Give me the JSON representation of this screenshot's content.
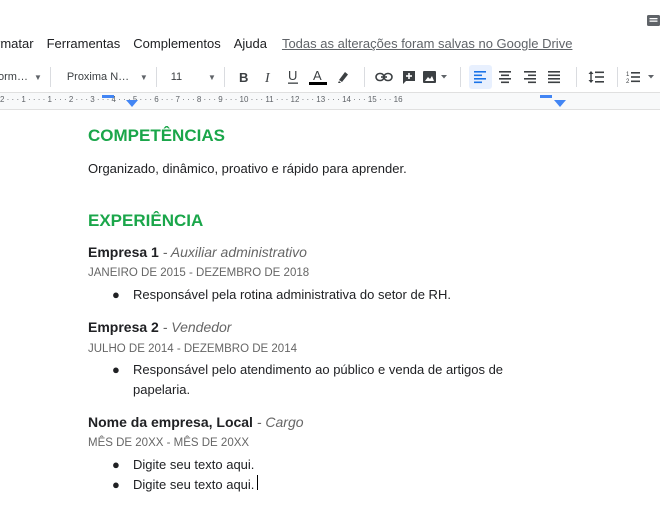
{
  "menu": {
    "items": [
      "rmatar",
      "Ferramentas",
      "Complementos",
      "Ajuda"
    ],
    "saved_status": "Todas as alterações foram salvas no Google Drive"
  },
  "toolbar": {
    "style_value": "orm…",
    "font_value": "Proxima N…",
    "size_value": "11",
    "text_color": "#000000"
  },
  "ruler": {
    "labels": "2 · · · 1 · · · · 1 · · · 2 · · · 3 · · · 4 · · · 5 · · · 6 · · · 7 · · · 8 · · · 9 · · · 10 · · · 11 · · · 12 · · · 13 · · · 14 · · · 15 · · · 16"
  },
  "document": {
    "competencias_heading": "COMPETÊNCIAS",
    "competencias_text": "Organizado, dinâmico, proativo e rápido para aprender.",
    "experiencia_heading": "EXPERIÊNCIA",
    "jobs": [
      {
        "company": "Empresa 1",
        "role": " - Auxiliar administrativo",
        "dates": "JANEIRO DE 2015 - DEZEMBRO DE 2018",
        "bullets": [
          "Responsável pela rotina administrativa do setor de RH."
        ]
      },
      {
        "company": "Empresa 2",
        "role": " - Vendedor",
        "dates": "JULHO DE 2014 - DEZEMBRO DE 2014",
        "bullets": [
          "Responsável pelo atendimento ao público e venda de artigos de papelaria."
        ]
      },
      {
        "company": "Nome da empresa, Local",
        "role": " - Cargo",
        "dates": "MÊS DE 20XX - MÊS DE 20XX",
        "bullets": [
          "Digite seu texto aqui.",
          "Digite seu texto aqui."
        ]
      }
    ],
    "heading_color": "#1aa64a"
  }
}
